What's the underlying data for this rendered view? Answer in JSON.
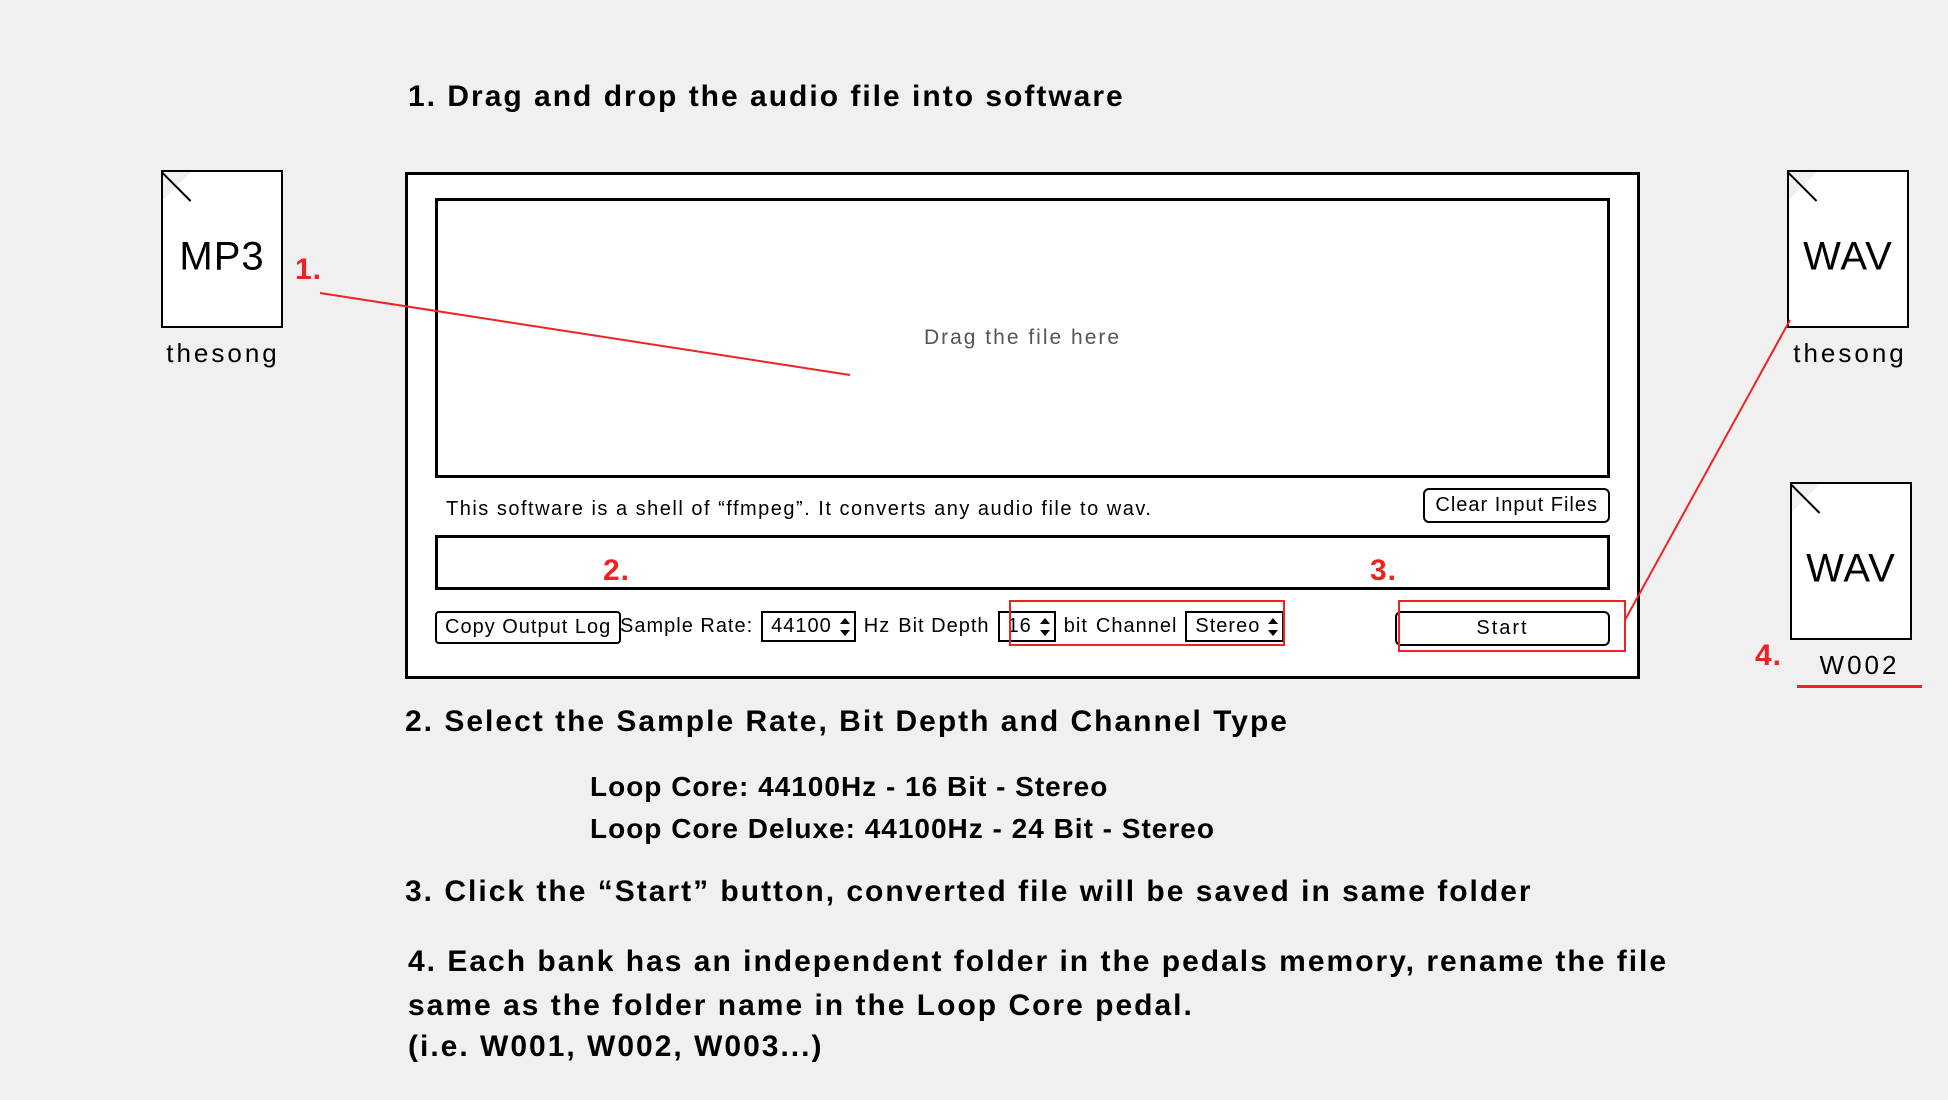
{
  "steps": {
    "s1": "1. Drag and drop the audio file into software",
    "s2": "2. Select the Sample Rate, Bit Depth and Channel Type",
    "s2_detail_a": "Loop Core: 44100Hz - 16 Bit - Stereo",
    "s2_detail_b": "Loop Core Deluxe: 44100Hz - 24 Bit - Stereo",
    "s3": "3. Click the “Start” button, converted file will be saved in same folder",
    "s4": "4. Each bank has an independent folder in the pedals memory, rename the file same as the folder name in the Loop Core pedal.",
    "s4_example": "(i.e. W001, W002, W003...)"
  },
  "files": {
    "input_ext": "MP3",
    "input_name": "thesong",
    "output1_ext": "WAV",
    "output1_name": "thesong",
    "output2_ext": "WAV",
    "output2_name": "W002"
  },
  "app": {
    "dropzone_text": "Drag the file here",
    "info_text": "This software is a shell of “ffmpeg”. It converts any audio file to wav.",
    "clear_btn": "Clear Input Files",
    "copy_btn": "Copy Output Log",
    "sample_rate_label": "Sample Rate:",
    "sample_rate_value": "44100",
    "sample_rate_unit": "Hz",
    "bit_depth_label": "Bit Depth",
    "bit_depth_value": "16",
    "bit_depth_unit": "bit",
    "channel_label": "Channel",
    "channel_value": "Stereo",
    "start_btn": "Start"
  },
  "annotations": {
    "n1": "1.",
    "n2": "2.",
    "n3": "3.",
    "n4": "4."
  }
}
